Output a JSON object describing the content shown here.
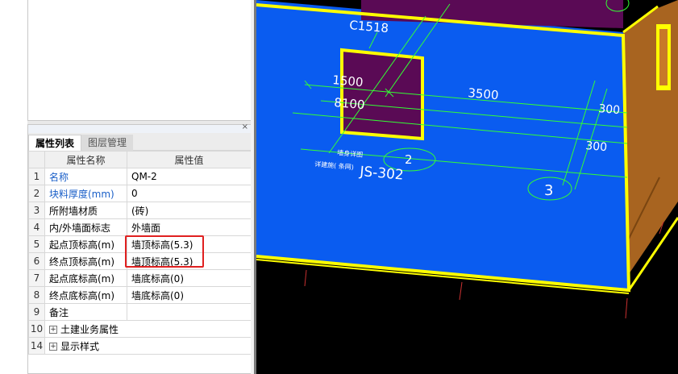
{
  "panel": {
    "close_glyph": "×",
    "tabs": [
      {
        "label": "属性列表"
      },
      {
        "label": "图层管理"
      }
    ],
    "columns": {
      "name": "属性名称",
      "value": "属性值"
    },
    "rows": [
      {
        "num": "1",
        "name": "名称",
        "value": "QM-2"
      },
      {
        "num": "2",
        "name": "块料厚度(mm)",
        "value": "0"
      },
      {
        "num": "3",
        "name": "所附墙材质",
        "value": "(砖)"
      },
      {
        "num": "4",
        "name": "内/外墙面标志",
        "value": "外墙面"
      },
      {
        "num": "5",
        "name": "起点顶标高(m)",
        "value": "墙顶标高(5.3)"
      },
      {
        "num": "6",
        "name": "终点顶标高(m)",
        "value": "墙顶标高(5.3)"
      },
      {
        "num": "7",
        "name": "起点底标高(m)",
        "value": "墙底标高(0)"
      },
      {
        "num": "8",
        "name": "终点底标高(m)",
        "value": "墙底标高(0)"
      },
      {
        "num": "9",
        "name": "备注",
        "value": ""
      },
      {
        "num": "10",
        "name": "土建业务属性",
        "value": "",
        "expander": "+"
      },
      {
        "num": "14",
        "name": "显示样式",
        "value": "",
        "expander": "+"
      }
    ]
  },
  "viewport": {
    "labels": {
      "window_tag": "C1518",
      "dim_1500": "1500",
      "dim_8100": "8100",
      "dim_3500": "3500",
      "dim_300_a": "300",
      "dim_300_b": "300",
      "axis_2": "2",
      "axis_3": "3",
      "detail_ref": "JS-302",
      "note_1": "墙身详图",
      "note_2": "详建施( 条网)"
    },
    "colors": {
      "wall": "#0a5cf0",
      "edge": "#ffff00",
      "dim_lines": "#33ff33",
      "window": "#5a0a55",
      "side": "#a86420",
      "axis_red": "#c83030"
    }
  }
}
